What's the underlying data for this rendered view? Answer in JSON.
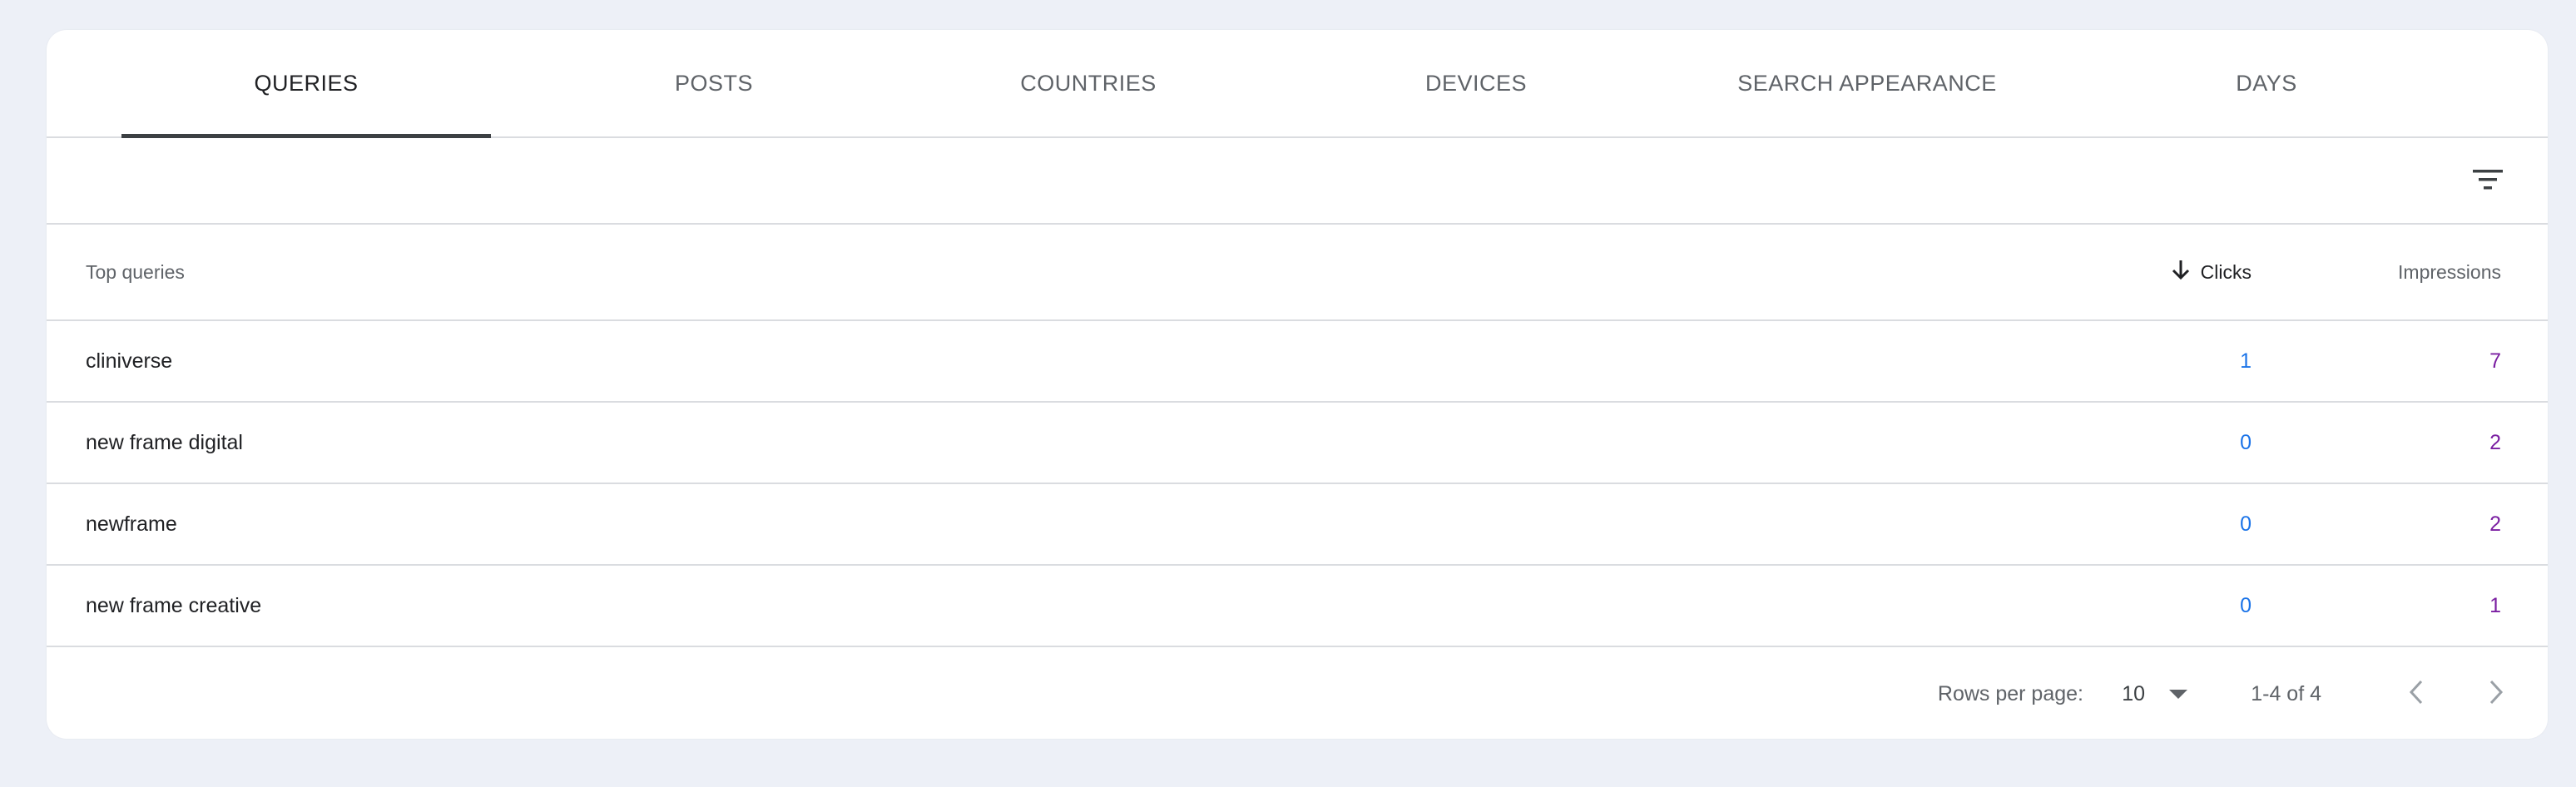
{
  "tabs": [
    {
      "label": "QUERIES",
      "active": true
    },
    {
      "label": "POSTS"
    },
    {
      "label": "COUNTRIES"
    },
    {
      "label": "DEVICES"
    },
    {
      "label": "SEARCH APPEARANCE"
    },
    {
      "label": "DAYS"
    }
  ],
  "icons": {
    "filter": "filter-icon",
    "sort": "arrow-down-icon",
    "dropdown": "caret-down-icon",
    "prev": "chevron-left-icon",
    "next": "chevron-right-icon"
  },
  "table": {
    "headers": {
      "query": "Top queries",
      "clicks": "Clicks",
      "impressions": "Impressions"
    },
    "sort": {
      "column": "clicks",
      "direction": "descending"
    },
    "rows": [
      {
        "query": "cliniverse",
        "clicks": "1",
        "impressions": "7"
      },
      {
        "query": "new frame digital",
        "clicks": "0",
        "impressions": "2"
      },
      {
        "query": "newframe",
        "clicks": "0",
        "impressions": "2"
      },
      {
        "query": "new frame creative",
        "clicks": "0",
        "impressions": "1"
      }
    ]
  },
  "pagination": {
    "rows_per_page_label": "Rows per page:",
    "rows_per_page": "10",
    "range": "1-4 of 4"
  },
  "colors": {
    "background": "#edf0f7",
    "clicks": "#1a73e8",
    "impressions": "#7b1fa2",
    "active_tab_indicator": "#3c4043"
  }
}
